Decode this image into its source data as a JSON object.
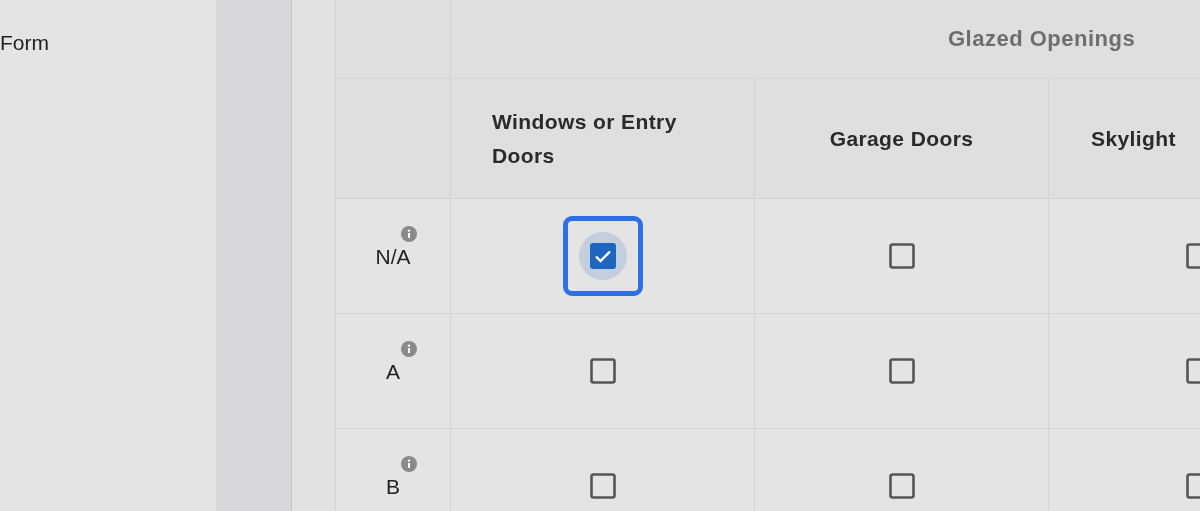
{
  "sidebar": {
    "title": "Form"
  },
  "table": {
    "group_header": "Glazed Openings",
    "columns": [
      "Windows or Entry Doors",
      "Garage Doors",
      "Skylight"
    ],
    "rows": [
      {
        "label": "N/A",
        "cells": [
          {
            "checked": true,
            "focused": true
          },
          {
            "checked": false,
            "focused": false
          },
          {
            "checked": false,
            "focused": false
          }
        ]
      },
      {
        "label": "A",
        "cells": [
          {
            "checked": false,
            "focused": false
          },
          {
            "checked": false,
            "focused": false
          },
          {
            "checked": false,
            "focused": false
          }
        ]
      },
      {
        "label": "B",
        "cells": [
          {
            "checked": false,
            "focused": false
          },
          {
            "checked": false,
            "focused": false
          },
          {
            "checked": false,
            "focused": false
          }
        ]
      }
    ]
  }
}
